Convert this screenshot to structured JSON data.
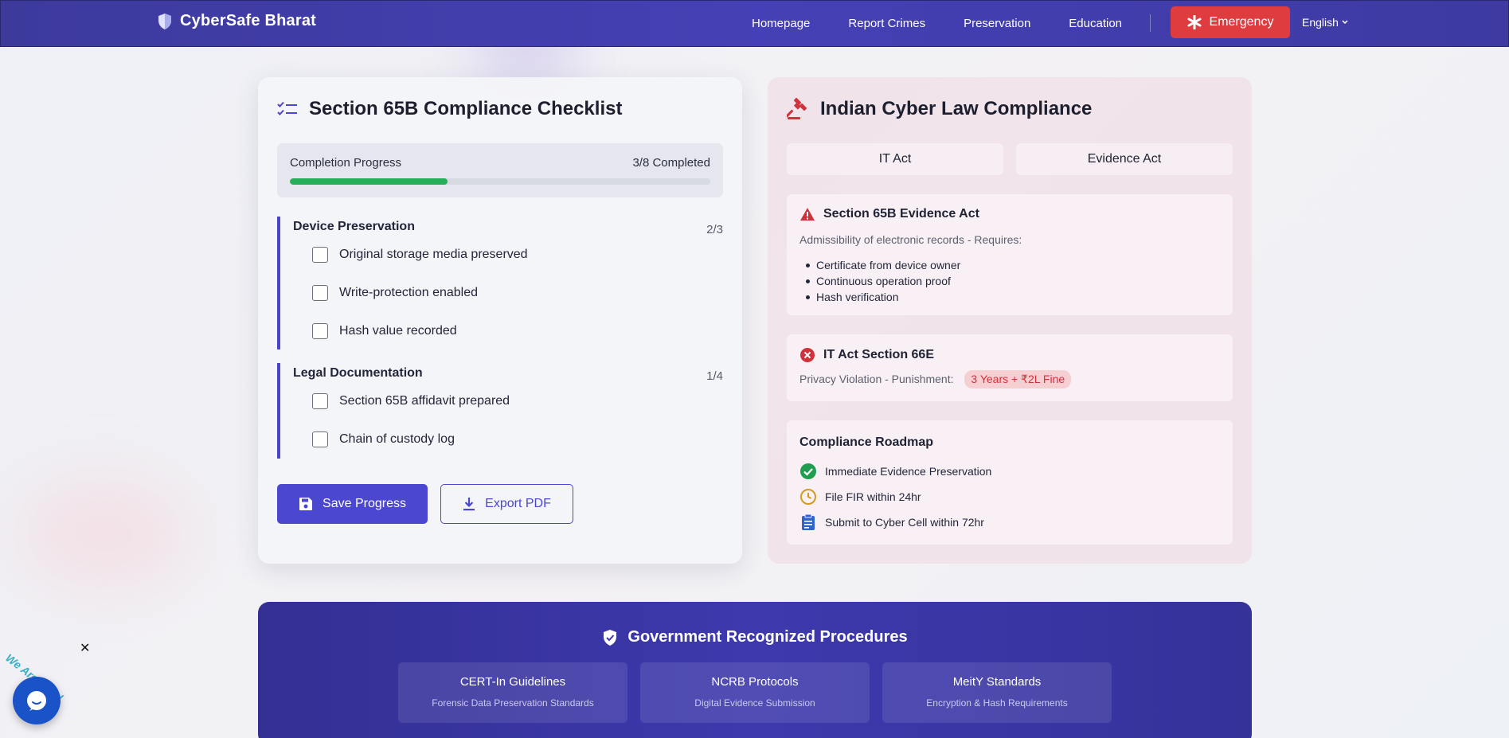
{
  "nav": {
    "brand": "CyberSafe Bharat",
    "links": [
      "Homepage",
      "Report Crimes",
      "Preservation",
      "Education"
    ],
    "emergency": "Emergency",
    "language": "English"
  },
  "checklist": {
    "title": "Section 65B Compliance Checklist",
    "progress_label": "Completion Progress",
    "progress_count": "3/8 Completed",
    "progress_fraction": 0.375,
    "groups": [
      {
        "title": "Device Preservation",
        "count": "2/3",
        "items": [
          "Original storage media preserved",
          "Write-protection enabled",
          "Hash value recorded"
        ]
      },
      {
        "title": "Legal Documentation",
        "count": "1/4",
        "items": [
          "Section 65B affidavit prepared",
          "Chain of custody log"
        ]
      }
    ],
    "save_label": "Save Progress",
    "export_label": "Export PDF"
  },
  "law": {
    "title": "Indian Cyber Law Compliance",
    "tabs": [
      "IT Act",
      "Evidence Act"
    ],
    "evidence": {
      "title": "Section 65B Evidence Act",
      "subtitle": "Admissibility of electronic records - Requires:",
      "requirements": [
        "Certificate from device owner",
        "Continuous operation proof",
        "Hash verification"
      ]
    },
    "itact": {
      "title": "IT Act Section 66E",
      "subtitle": "Privacy Violation - Punishment:",
      "badge": "3 Years + ₹2L Fine"
    },
    "roadmap": {
      "title": "Compliance Roadmap",
      "steps": [
        {
          "label": "Immediate Evidence Preservation",
          "icon": "check-circle-icon",
          "color": "#1e9e4e"
        },
        {
          "label": "File FIR within 24hr",
          "icon": "clock-icon",
          "color": "#d39b1c"
        },
        {
          "label": "Submit to Cyber Cell within 72hr",
          "icon": "clipboard-icon",
          "color": "#2f62d6"
        }
      ]
    }
  },
  "gov": {
    "title": "Government Recognized Procedures",
    "cards": [
      {
        "title": "CERT-In Guidelines",
        "sub": "Forensic Data Preservation Standards"
      },
      {
        "title": "NCRB Protocols",
        "sub": "Digital Evidence Submission"
      },
      {
        "title": "MeitY Standards",
        "sub": "Encryption & Hash Requirements"
      }
    ]
  },
  "chat": {
    "tagline": "We Are Here!",
    "close": "✕"
  },
  "colors": {
    "primary": "#4c47d0",
    "nav": "#4540b5",
    "emergency": "#de3c3f",
    "success": "#27ae5a",
    "danger": "#d0323b"
  }
}
